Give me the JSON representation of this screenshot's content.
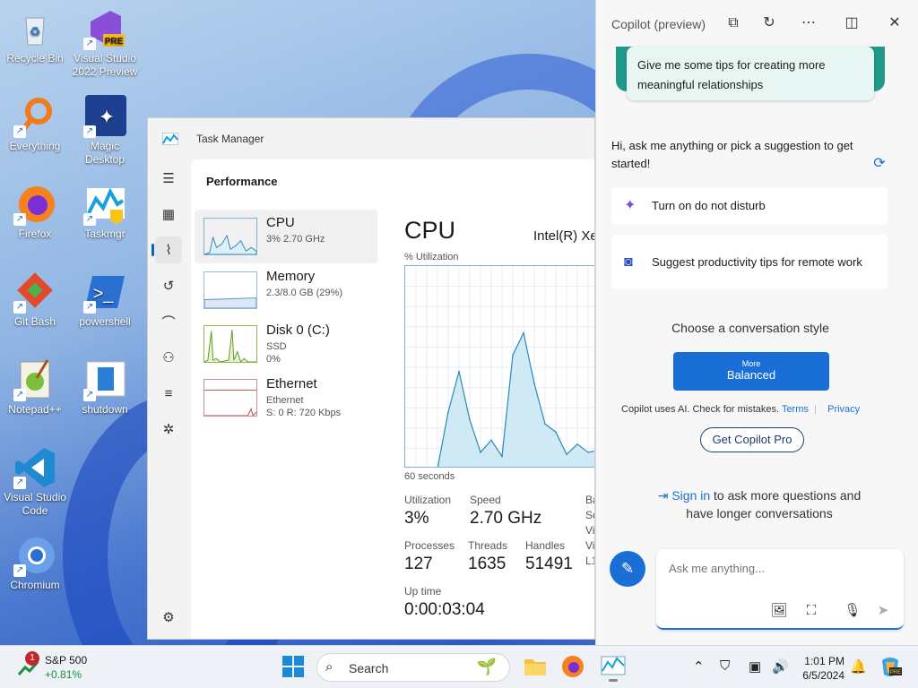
{
  "desktop": {
    "icons": [
      {
        "label": "Recycle Bin",
        "icon": "recycle-bin-icon"
      },
      {
        "label": "Visual Studio 2022 Preview",
        "icon": "visual-studio-preview-icon",
        "badge": "PRE"
      },
      {
        "label": "Everything",
        "icon": "everything-search-icon"
      },
      {
        "label": "Magic Desktop",
        "icon": "magic-desktop-icon"
      },
      {
        "label": "Firefox",
        "icon": "firefox-icon"
      },
      {
        "label": "Taskmgr",
        "icon": "task-manager-icon"
      },
      {
        "label": "Git Bash",
        "icon": "git-bash-icon"
      },
      {
        "label": "powershell",
        "icon": "powershell-icon"
      },
      {
        "label": "Notepad++",
        "icon": "notepad-plus-plus-icon"
      },
      {
        "label": "shutdown",
        "icon": "shutdown-icon"
      },
      {
        "label": "Visual Studio Code",
        "icon": "vscode-icon"
      },
      {
        "label": "Chromium",
        "icon": "chromium-icon"
      }
    ]
  },
  "task_manager": {
    "title": "Task Manager",
    "section": "Performance",
    "rail_icons": [
      "hamburger-menu-icon",
      "processes-icon",
      "performance-icon",
      "app-history-icon",
      "startup-apps-icon",
      "users-icon",
      "details-icon",
      "services-icon",
      "settings-icon"
    ],
    "perf_items": [
      {
        "name": "CPU",
        "sub1": "3% 2.70 GHz",
        "sub2": ""
      },
      {
        "name": "Memory",
        "sub1": "2.3/8.0 GB (29%)",
        "sub2": ""
      },
      {
        "name": "Disk 0 (C:)",
        "sub1": "SSD",
        "sub2": "0%"
      },
      {
        "name": "Ethernet",
        "sub1": "Ethernet",
        "sub2": "S: 0 R: 720 Kbps"
      }
    ],
    "cpu": {
      "heading": "CPU",
      "model": "Intel(R) Xe",
      "util_label": "% Utilization",
      "graph_span": "60 seconds",
      "utilization_label": "Utilization",
      "utilization": "3%",
      "speed_label": "Speed",
      "speed": "2.70 GHz",
      "processes_label": "Processes",
      "processes": "127",
      "threads_label": "Threads",
      "threads": "1635",
      "handles_label": "Handles",
      "handles": "51491",
      "uptime_label": "Up time",
      "uptime": "0:00:03:04",
      "right_col": [
        "Ba",
        "So",
        "Vi",
        "Vi",
        "L1"
      ]
    }
  },
  "chart_data": {
    "type": "area",
    "title": "",
    "xlabel": "60 seconds",
    "ylabel": "% Utilization",
    "ylim": [
      0,
      100
    ],
    "x": [
      0,
      3,
      6,
      9,
      12,
      15,
      18,
      21,
      24,
      27,
      30,
      33,
      36,
      39,
      42,
      45,
      48,
      51,
      54,
      57,
      60
    ],
    "values": [
      0,
      0,
      0,
      0,
      28,
      48,
      24,
      8,
      14,
      6,
      56,
      67,
      42,
      22,
      18,
      7,
      12,
      8,
      9,
      5,
      6
    ]
  },
  "copilot": {
    "title": "Copilot (preview)",
    "header_icons": [
      "open-in-new-icon",
      "refresh-icon",
      "more-icon",
      "dock-icon",
      "close-icon"
    ],
    "tip": "Give me some tips for creating more meaningful relationships",
    "greeting": "Hi, ask me anything or pick a suggestion to get started!",
    "suggestions": [
      "Turn on do not disturb",
      "Suggest productivity tips for remote work"
    ],
    "style_label": "Choose a conversation style",
    "style_top": "More",
    "style_main": "Balanced",
    "disclaimer": "Copilot uses AI. Check for mistakes.",
    "terms": "Terms",
    "privacy": "Privacy",
    "get_pro": "Get Copilot Pro",
    "signin_link": "Sign in",
    "signin_rest": "to ask more questions and have longer conversations",
    "input_placeholder": "Ask me anything..."
  },
  "taskbar": {
    "stock_name": "S&P 500",
    "stock_change": "+0.81%",
    "stock_badge": "1",
    "search_label": "Search",
    "time": "1:01 PM",
    "date": "6/5/2024"
  },
  "colors": {
    "accent": "#1a6fd6",
    "cpu_graph": "#7fb2cf",
    "copilot_band": "#1f9a8a"
  }
}
